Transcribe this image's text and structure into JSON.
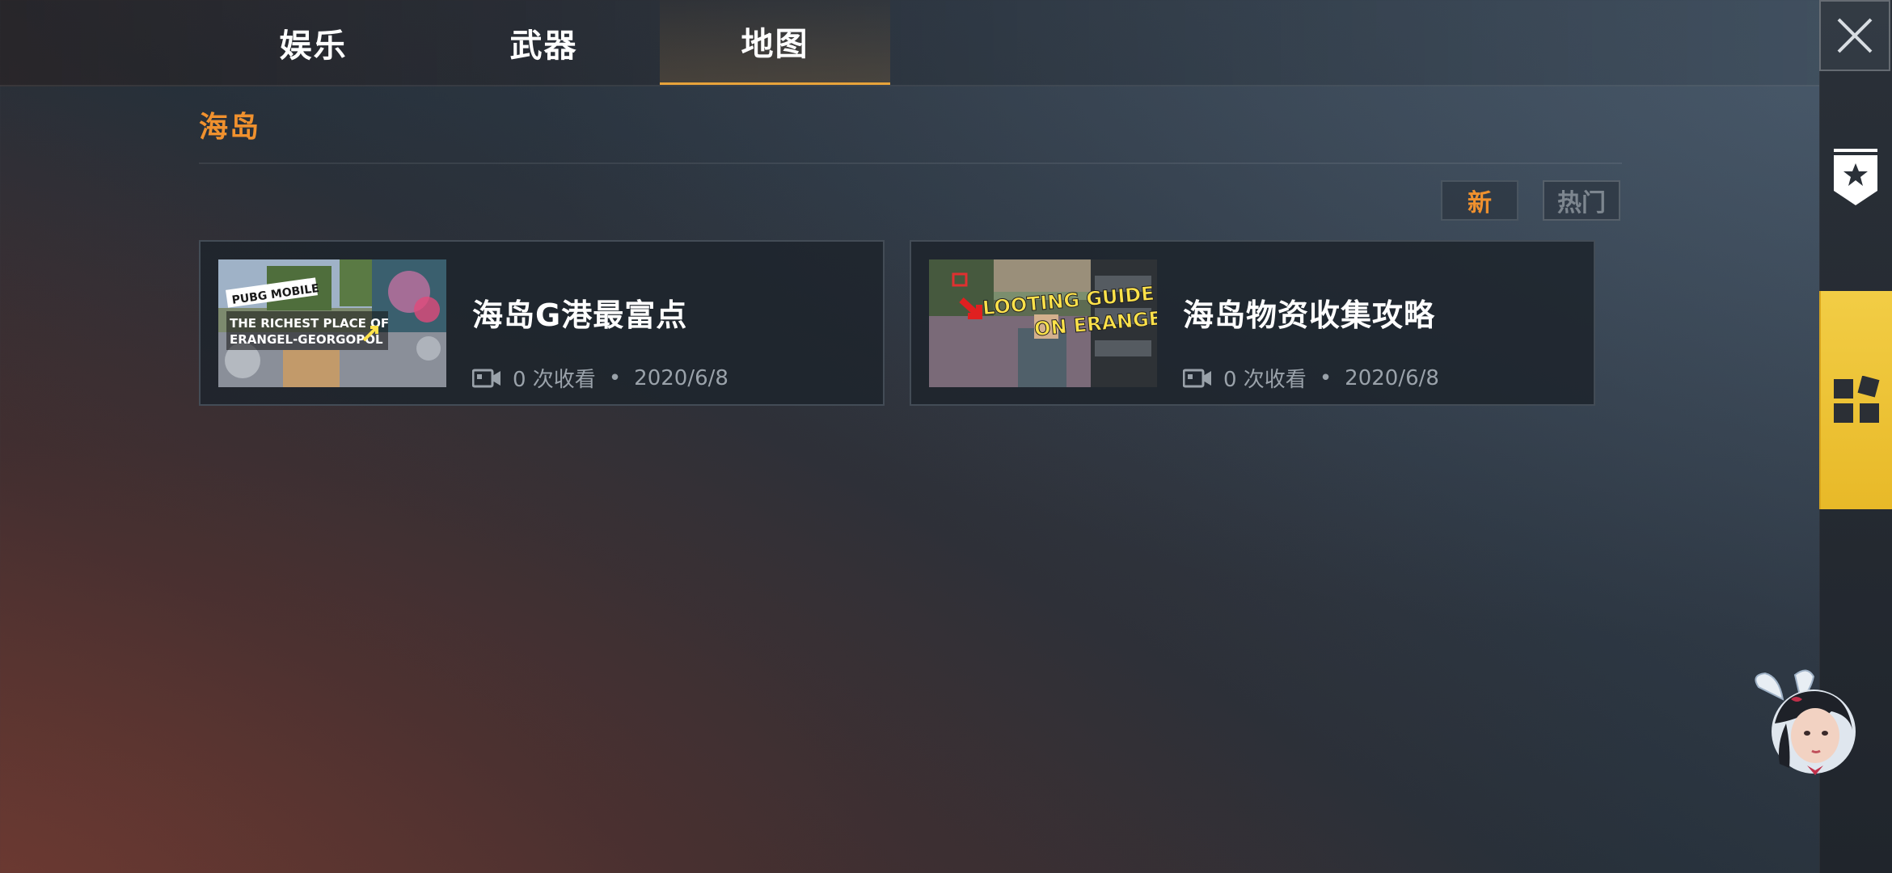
{
  "tabs": [
    {
      "label": "娱乐",
      "active": false
    },
    {
      "label": "武器",
      "active": false
    },
    {
      "label": "地图",
      "active": true
    }
  ],
  "section": {
    "title": "海岛"
  },
  "sort": {
    "new_label": "新",
    "hot_label": "热门",
    "selected": "新"
  },
  "videos": [
    {
      "title": "海岛G港最富点",
      "views": "0 次收看",
      "separator": "•",
      "date": "2020/6/8",
      "thumbnail_text": [
        "PUBG MOBILE",
        "THE RICHEST PLACE OF",
        "ERANGEL-GEORGOPOL"
      ]
    },
    {
      "title": "海岛物资收集攻略",
      "views": "0 次收看",
      "separator": "•",
      "date": "2020/6/8",
      "thumbnail_text": [
        "LOOTING GUIDE",
        "ON ERANGEL"
      ]
    }
  ],
  "colors": {
    "accent": "#f0912e",
    "tab_underline": "#e8a33a",
    "rail_highlight": "#f2cd45"
  },
  "icons": {
    "close": "close-icon",
    "favorite": "star-badge-icon",
    "apps": "apps-grid-icon",
    "video": "video-camera-icon",
    "avatar": "character-avatar"
  }
}
